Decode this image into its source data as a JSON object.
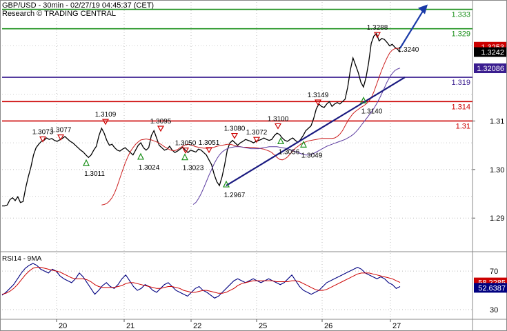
{
  "header": {
    "line1": "GBP/USD - 30min - 02/27/19 04:45:37 (CET)",
    "line2": "Research © TRADING CENTRAL"
  },
  "chart_data": [
    {
      "type": "line",
      "title": "GBP/USD - 30min",
      "x_labels": [
        "20",
        "21",
        "22",
        "25",
        "26",
        "27"
      ],
      "y_ticks": [
        1.29,
        1.3,
        1.31
      ],
      "y_tick_labels": [
        "1.29",
        "1.30",
        "1.31"
      ],
      "ylim": [
        1.2835,
        1.3345
      ],
      "grid": true,
      "series": [
        {
          "values": [
            1.2925,
            1.2925,
            1.2927,
            1.2938,
            1.2942,
            1.2936,
            1.2944,
            1.2932,
            1.2934,
            1.2962,
            1.2985,
            1.3005,
            1.303,
            1.3045,
            1.3052,
            1.3058,
            1.306,
            1.3065,
            1.3062,
            1.3064,
            1.306,
            1.3058,
            1.3061,
            1.3064,
            1.3068,
            1.3063,
            1.3058,
            1.3055,
            1.305,
            1.3045,
            1.304,
            1.3036,
            1.303,
            1.3025,
            1.303,
            1.304,
            1.3048,
            1.307,
            1.3085,
            1.3075,
            1.306,
            1.305,
            1.3052,
            1.3045,
            1.304,
            1.3038,
            1.3042,
            1.3045,
            1.304,
            1.3035,
            1.303,
            1.304,
            1.305,
            1.3055,
            1.3045,
            1.304,
            1.3045,
            1.307,
            1.308,
            1.3065,
            1.305,
            1.3045,
            1.304,
            1.3042,
            1.3048,
            1.304,
            1.3035,
            1.3038,
            1.3042,
            1.3046,
            1.304,
            1.3035,
            1.304,
            1.3038,
            1.3036,
            1.3042,
            1.304,
            1.3035,
            1.303,
            1.302,
            1.301,
            1.299,
            1.2975,
            1.2967,
            1.2985,
            1.301,
            1.304,
            1.3055,
            1.306,
            1.3055,
            1.305,
            1.3055,
            1.3058,
            1.3062,
            1.306,
            1.3058,
            1.3055,
            1.3058,
            1.306,
            1.3062,
            1.3065,
            1.3062,
            1.306,
            1.3062,
            1.307,
            1.3075,
            1.3072,
            1.3065,
            1.306,
            1.3058,
            1.3062,
            1.3065,
            1.306,
            1.3056,
            1.3062,
            1.307,
            1.308,
            1.3085,
            1.309,
            1.3105,
            1.3125,
            1.3135,
            1.313,
            1.3128,
            1.3135,
            1.314,
            1.313,
            1.3135,
            1.3138,
            1.3135,
            1.314,
            1.3145,
            1.317,
            1.3205,
            1.323,
            1.3215,
            1.32,
            1.318,
            1.317,
            1.319,
            1.322,
            1.326,
            1.3275,
            1.328,
            1.3265,
            1.327,
            1.3268,
            1.3262,
            1.3255,
            1.3258,
            1.3252,
            1.3248,
            1.3242
          ]
        },
        {
          "values": [
            1.2927,
            1.2928,
            1.293,
            1.2935,
            1.2942,
            1.2952,
            1.2966,
            1.2982,
            1.2998,
            1.3013,
            1.3026,
            1.3037,
            1.3045,
            1.3052,
            1.3057,
            1.3061,
            1.3062,
            1.3063,
            1.3062,
            1.3061,
            1.3059,
            1.3057,
            1.3054,
            1.3051,
            1.3047,
            1.3044,
            1.3041,
            1.3039,
            1.3039,
            1.3041,
            1.3045,
            1.3048,
            1.3051,
            1.3052,
            1.3051,
            1.3049,
            1.3047,
            1.3046,
            1.3045,
            1.3044,
            1.3044,
            1.3044,
            1.3045,
            1.3046,
            1.3048,
            1.3049,
            1.305,
            1.3051,
            1.3052,
            1.3052,
            1.3051,
            1.3049,
            1.3048,
            1.3047,
            1.3046,
            1.3046,
            1.3046,
            1.3046,
            1.3046,
            1.3045,
            1.3044,
            1.3043,
            1.3042,
            1.304,
            1.3038,
            1.3035,
            1.303,
            1.3025,
            1.3021,
            1.302,
            1.3022,
            1.3026,
            1.3032,
            1.3038,
            1.3044,
            1.3048,
            1.3052,
            1.3055,
            1.3057,
            1.3059,
            1.306,
            1.3061,
            1.3062,
            1.3063,
            1.3064,
            1.3064,
            1.3064,
            1.3064,
            1.3064,
            1.3065,
            1.3068,
            1.3073,
            1.308,
            1.309,
            1.31,
            1.3108,
            1.3115,
            1.312,
            1.3124,
            1.3128,
            1.3131,
            1.3135,
            1.314,
            1.3148,
            1.316,
            1.3175,
            1.319,
            1.3205,
            1.3218,
            1.323,
            1.324,
            1.3246,
            1.3249,
            1.325,
            1.3249
          ]
        },
        {
          "values": [
            1.2928,
            1.2932,
            1.294,
            1.295,
            1.2962,
            1.2975,
            1.2988,
            1.3,
            1.3012,
            1.3022,
            1.303,
            1.3036,
            1.304,
            1.3043,
            1.3045,
            1.3046,
            1.3047,
            1.3047,
            1.3047,
            1.3046,
            1.3045,
            1.3044,
            1.3043,
            1.3043,
            1.3043,
            1.3043,
            1.3044,
            1.3045,
            1.3046,
            1.3047,
            1.3047,
            1.3047,
            1.3047,
            1.3046,
            1.3045,
            1.3044,
            1.3043,
            1.3041,
            1.3039,
            1.3037,
            1.3035,
            1.3033,
            1.3031,
            1.303,
            1.303,
            1.3031,
            1.3033,
            1.3036,
            1.3039,
            1.3042,
            1.3045,
            1.3048,
            1.305,
            1.3052,
            1.3054,
            1.3056,
            1.3058,
            1.306,
            1.3062,
            1.3065,
            1.3068,
            1.3072,
            1.3077,
            1.3083,
            1.309,
            1.3097,
            1.3104,
            1.3111,
            1.3118,
            1.3126,
            1.3135,
            1.3145,
            1.3156,
            1.3168,
            1.318,
            1.319,
            1.3198,
            1.3204,
            1.3207,
            1.3209
          ]
        }
      ],
      "hlines": [
        {
          "value": 1.333,
          "label": "1.333",
          "color": "#1a8f1a"
        },
        {
          "value": 1.329,
          "label": "1.329",
          "color": "#1a8f1a"
        },
        {
          "value": 1.319,
          "label": "1.319",
          "color": "#3a1d8f"
        },
        {
          "value": 1.314,
          "label": "1.314",
          "color": "#cc0000"
        },
        {
          "value": 1.31,
          "label": "1.31",
          "color": "#cc0000"
        }
      ],
      "trendline": {
        "from": [
          1.2967,
          1.319
        ],
        "color": "#1a1a80"
      },
      "arrow": {
        "from": 1.325,
        "to": 1.334,
        "color": "#1a3aa8"
      },
      "price_tags": [
        {
          "label": "1.3253",
          "color": "#cc0000",
          "text_color": "#ffffff",
          "value": 1.3253
        },
        {
          "label": "1.3242",
          "color": "#000000",
          "text_color": "#ffffff",
          "value": 1.3242
        },
        {
          "label": "1.32086",
          "color": "#3a1d8f",
          "text_color": "#ffffff",
          "value": 1.32086
        }
      ],
      "annotations": [
        {
          "text": "1.3073",
          "kind": "high",
          "value": 1.3073
        },
        {
          "text": "1.3077",
          "kind": "high",
          "value": 1.3077
        },
        {
          "text": "1.3109",
          "kind": "high",
          "value": 1.3109
        },
        {
          "text": "1.3095",
          "kind": "high",
          "value": 1.3095
        },
        {
          "text": "1.3050",
          "kind": "high",
          "value": 1.305
        },
        {
          "text": "1.3051",
          "kind": "high",
          "value": 1.3051
        },
        {
          "text": "1.3080",
          "kind": "high",
          "value": 1.308
        },
        {
          "text": "1.3072",
          "kind": "high",
          "value": 1.3072
        },
        {
          "text": "1.3100",
          "kind": "high",
          "value": 1.31
        },
        {
          "text": "1.3149",
          "kind": "high",
          "value": 1.3149
        },
        {
          "text": "1.3288",
          "kind": "high",
          "value": 1.3288
        },
        {
          "text": "1.3240",
          "kind": "high",
          "value": 1.324
        },
        {
          "text": "1.3011",
          "kind": "low",
          "value": 1.3011
        },
        {
          "text": "1.3024",
          "kind": "low",
          "value": 1.3024
        },
        {
          "text": "1.3023",
          "kind": "low",
          "value": 1.3023
        },
        {
          "text": "1.2967",
          "kind": "low",
          "value": 1.2967
        },
        {
          "text": "1.3056",
          "kind": "low",
          "value": 1.3056
        },
        {
          "text": "1.3049",
          "kind": "low",
          "value": 1.3049
        },
        {
          "text": "1.3140",
          "kind": "low",
          "value": 1.314
        }
      ]
    },
    {
      "type": "line",
      "title": "RSI14 - 9MA",
      "x_labels": [
        "20",
        "21",
        "22",
        "25",
        "26",
        "27"
      ],
      "y_ticks": [
        30,
        70
      ],
      "y_tick_labels": [
        "30",
        "70"
      ],
      "ylim": [
        20,
        88
      ],
      "grid": true,
      "series": [
        {
          "values": [
            45,
            48,
            52,
            56,
            62,
            68,
            73,
            76,
            78,
            76,
            72,
            70,
            68,
            72,
            70,
            65,
            62,
            60,
            58,
            62,
            68,
            64,
            58,
            52,
            46,
            50,
            55,
            58,
            54,
            52,
            56,
            62,
            66,
            60,
            54,
            50,
            52,
            56,
            54,
            50,
            48,
            52,
            56,
            58,
            54,
            50,
            48,
            46,
            44,
            48,
            52,
            54,
            50,
            48,
            45,
            42,
            44,
            48,
            52,
            56,
            60,
            62,
            60,
            58,
            60,
            62,
            60,
            58,
            60,
            62,
            60,
            58,
            56,
            58,
            62,
            66,
            60,
            54,
            50,
            48,
            46,
            48,
            50,
            54,
            58,
            60,
            62,
            64,
            66,
            68,
            70,
            72,
            74,
            72,
            68,
            66,
            64,
            62,
            64,
            62,
            58,
            56,
            52,
            54
          ],
          "color": "#000080"
        },
        {
          "values": [
            46,
            47,
            49,
            52,
            56,
            61,
            66,
            70,
            73,
            74,
            74,
            73,
            72,
            71,
            70,
            69,
            67,
            65,
            63,
            62,
            62,
            62,
            61,
            59,
            56,
            54,
            53,
            53,
            53,
            53,
            54,
            55,
            57,
            58,
            58,
            57,
            56,
            55,
            54,
            53,
            52,
            52,
            53,
            54,
            54,
            53,
            52,
            50,
            49,
            48,
            48,
            49,
            50,
            50,
            49,
            48,
            47,
            47,
            48,
            50,
            52,
            55,
            57,
            58,
            59,
            60,
            60,
            60,
            60,
            60,
            60,
            59,
            59,
            59,
            59,
            60,
            60,
            59,
            57,
            55,
            53,
            51,
            50,
            50,
            51,
            53,
            55,
            57,
            59,
            61,
            63,
            65,
            67,
            68,
            68,
            68,
            67,
            66,
            65,
            64,
            63,
            62,
            60,
            58.2
          ],
          "color": "#cc0000"
        }
      ],
      "price_tags": [
        {
          "label": "58.2285",
          "color": "#cc0000",
          "text_color": "#ffffff",
          "value": 58.2285
        },
        {
          "label": "52.6387",
          "color": "#000080",
          "text_color": "#ffffff",
          "value": 52.6387
        }
      ]
    }
  ]
}
